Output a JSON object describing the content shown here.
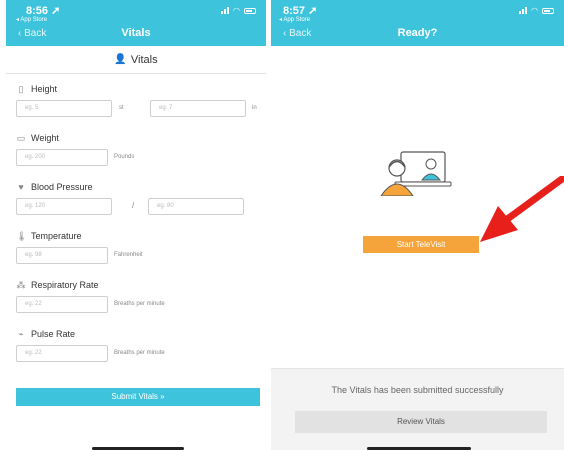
{
  "left": {
    "status": {
      "time": "8:56 ➚",
      "back_app": "◂ App Store"
    },
    "nav": {
      "back": "‹ Back",
      "title": "Vitals"
    },
    "section_title": "Vitals",
    "fields": {
      "height": {
        "label": "Height",
        "ph_ft": "eg. 5",
        "unit_ft": "st",
        "ph_in": "eg. 7",
        "unit_in": "in"
      },
      "weight": {
        "label": "Weight",
        "ph": "eg. 200",
        "unit": "Pounds"
      },
      "bp": {
        "label": "Blood Pressure",
        "ph1": "eg. 120",
        "sep": "/",
        "ph2": "eg. 80"
      },
      "temp": {
        "label": "Temperature",
        "ph": "eg. 98",
        "unit": "Fahrenheit"
      },
      "resp": {
        "label": "Respiratory Rate",
        "ph": "eg. 22",
        "unit": "Breaths per minute"
      },
      "pulse": {
        "label": "Pulse Rate",
        "ph": "eg. 22",
        "unit": "Breaths per minute"
      }
    },
    "submit_label": "Submit Vitals »"
  },
  "right": {
    "status": {
      "time": "8:57 ➚",
      "back_app": "◂ App Store"
    },
    "nav": {
      "back": "‹ Back",
      "title": "Ready?"
    },
    "start_label": "Start TeleVisit",
    "success_message": "The Vitals has been submitted successfully",
    "review_label": "Review Vitals"
  },
  "colors": {
    "accent": "#3ec3dc",
    "orange": "#f4a43b",
    "arrow": "#e8201c"
  }
}
